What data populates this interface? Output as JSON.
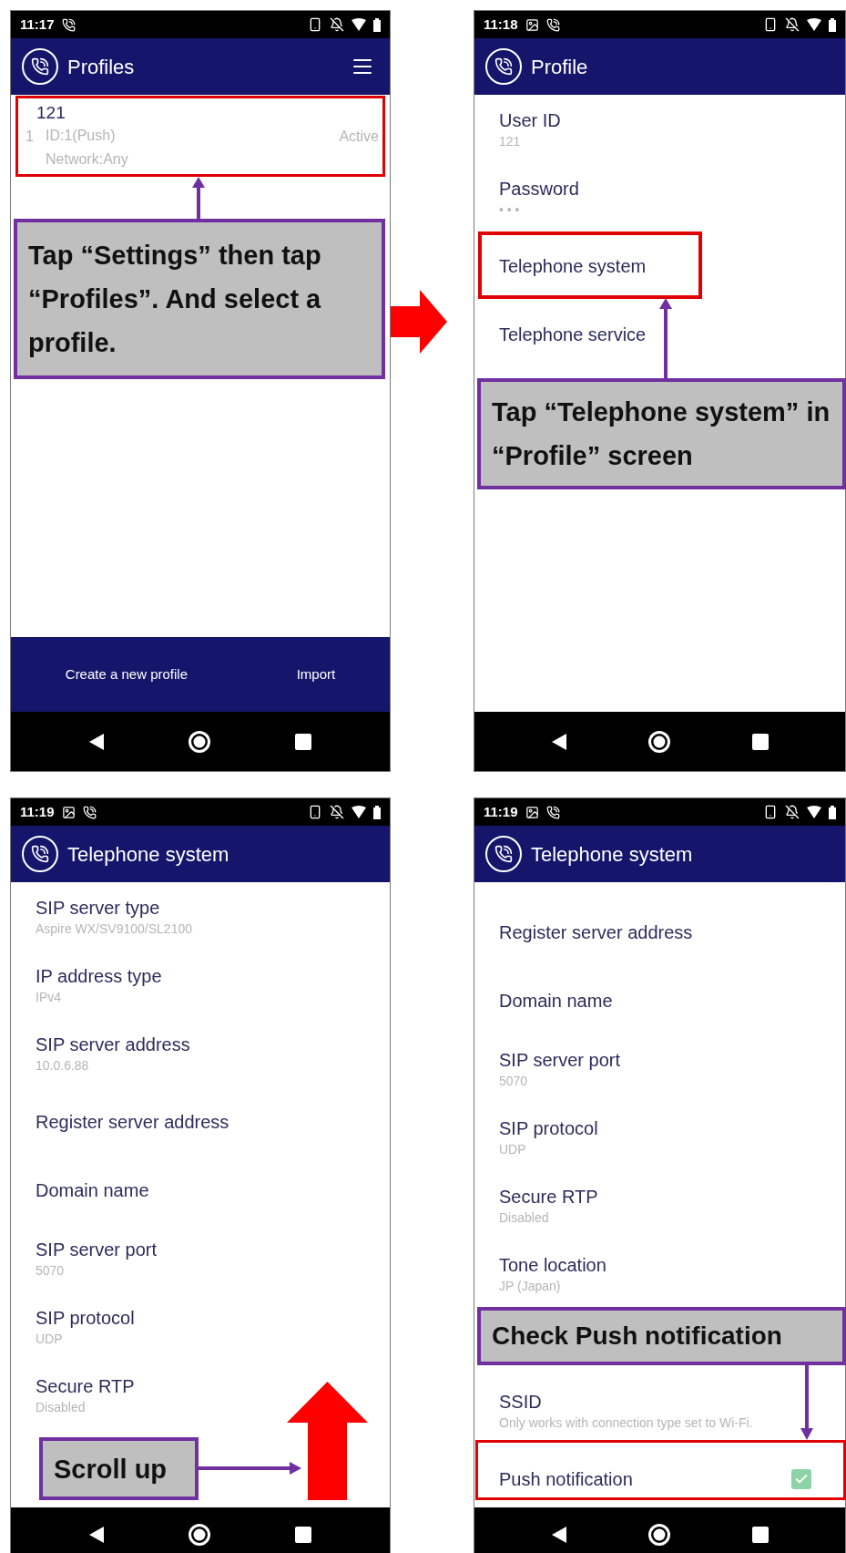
{
  "panels": [
    {
      "status": {
        "time": "11:17",
        "left_icons": [
          {
            "kind": "call"
          }
        ]
      },
      "app_bar": {
        "title": "Profiles",
        "menu": true
      },
      "kind": "profiles",
      "profiles": [
        {
          "name": "121",
          "number": "1",
          "id": "ID:1(Push)",
          "network": "Network:Any",
          "status": "Active"
        }
      ],
      "actions": [
        "Create a new profile",
        "Import"
      ],
      "callout": "Tap “Settings” then tap “Profiles”. And select a profile."
    },
    {
      "status": {
        "time": "11:18",
        "left_icons": [
          {
            "kind": "image"
          },
          {
            "kind": "call"
          }
        ]
      },
      "app_bar": {
        "title": "Profile",
        "menu": false
      },
      "kind": "settings",
      "settings": [
        {
          "kind": "item",
          "title": "User ID",
          "summary": "121"
        },
        {
          "kind": "item",
          "title": "Password",
          "summary": "• • •"
        },
        {
          "kind": "item",
          "title": "Telephone system"
        },
        {
          "kind": "item",
          "title": "Telephone service"
        }
      ],
      "callout": "Tap “Telephone system” in “Profile” screen"
    },
    {
      "status": {
        "time": "11:19",
        "left_icons": [
          {
            "kind": "image"
          },
          {
            "kind": "call"
          }
        ]
      },
      "app_bar": {
        "title": "Telephone system",
        "menu": false
      },
      "kind": "settings",
      "settings": [
        {
          "kind": "item",
          "title": "SIP server type",
          "summary": "Aspire WX/SV9100/SL2100"
        },
        {
          "kind": "item",
          "title": "IP address type",
          "summary": "IPv4"
        },
        {
          "kind": "item",
          "title": "SIP server address",
          "summary": "10.0.6.88"
        },
        {
          "kind": "item",
          "title": "Register server address"
        },
        {
          "kind": "item",
          "title": "Domain name"
        },
        {
          "kind": "item",
          "title": "SIP server port",
          "summary": "5070"
        },
        {
          "kind": "item",
          "title": "SIP protocol",
          "summary": "UDP"
        },
        {
          "kind": "item",
          "title": "Secure RTP",
          "summary": "Disabled"
        }
      ],
      "callout": "Scroll up"
    },
    {
      "status": {
        "time": "11:19",
        "left_icons": [
          {
            "kind": "image"
          },
          {
            "kind": "call"
          }
        ]
      },
      "app_bar": {
        "title": "Telephone system",
        "menu": false
      },
      "kind": "settings",
      "settings": [
        {
          "kind": "item",
          "title": "Register server address"
        },
        {
          "kind": "item",
          "title": "Domain name"
        },
        {
          "kind": "item",
          "title": "SIP server port",
          "summary": "5070"
        },
        {
          "kind": "item",
          "title": "SIP protocol",
          "summary": "UDP"
        },
        {
          "kind": "item",
          "title": "Secure RTP",
          "summary": "Disabled"
        },
        {
          "kind": "item",
          "title": "Tone location",
          "summary": "JP (Japan)"
        },
        {
          "kind": "covered"
        },
        {
          "kind": "item",
          "title": "SSID",
          "summary": "Only works with connection type set to Wi-Fi."
        },
        {
          "kind": "checkbox",
          "title": "Push notification",
          "checked": true
        }
      ],
      "callout": "Check Push notification"
    }
  ]
}
